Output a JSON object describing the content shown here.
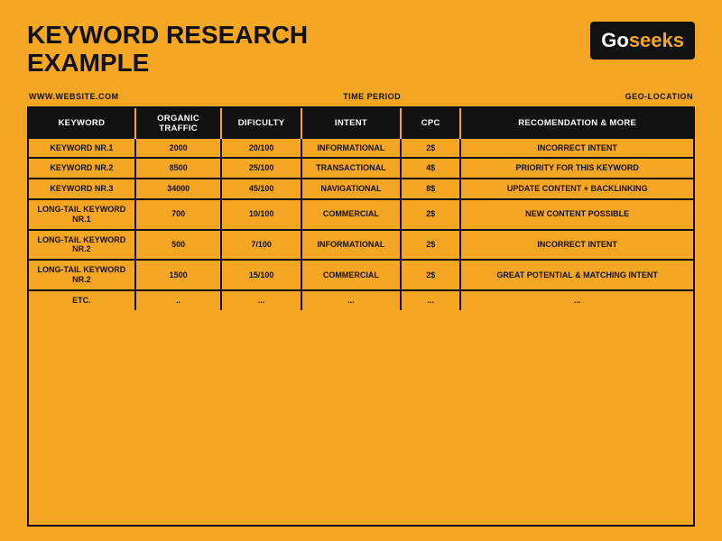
{
  "header": {
    "title_line1": "KEYWORD RESEARCH",
    "title_line2": "EXAMPLE",
    "logo_go": "Go",
    "logo_seeks": "seeks"
  },
  "meta": {
    "website": "WWW.WEBSITE.COM",
    "time_period": "TIME PERIOD",
    "geo_location": "GEO-LOCATION"
  },
  "table": {
    "columns": [
      {
        "id": "keyword",
        "label": "KEYWORD"
      },
      {
        "id": "traffic",
        "label": "ORGANIC TRAFFIC"
      },
      {
        "id": "difficulty",
        "label": "DIFICULTY"
      },
      {
        "id": "intent",
        "label": "INTENT"
      },
      {
        "id": "cpc",
        "label": "CPC"
      },
      {
        "id": "recommendation",
        "label": "RECOMENDATION & MORE"
      }
    ],
    "rows": [
      {
        "keyword": "KEYWORD NR.1",
        "traffic": "2000",
        "difficulty": "20/100",
        "intent": "INFORMATIONAL",
        "cpc": "2$",
        "recommendation": "INCORRECT INTENT"
      },
      {
        "keyword": "KEYWORD NR.2",
        "traffic": "8500",
        "difficulty": "25/100",
        "intent": "TRANSACTIONAL",
        "cpc": "4$",
        "recommendation": "PRIORITY FOR THIS KEYWORD"
      },
      {
        "keyword": "KEYWORD NR.3",
        "traffic": "34000",
        "difficulty": "45/100",
        "intent": "NAVIGATIONAL",
        "cpc": "8$",
        "recommendation": "UPDATE CONTENT + BACKLINKING"
      },
      {
        "keyword": "LONG-TAIL KEYWORD NR.1",
        "traffic": "700",
        "difficulty": "10/100",
        "intent": "COMMERCIAL",
        "cpc": "2$",
        "recommendation": "NEW CONTENT POSSIBLE"
      },
      {
        "keyword": "LONG-TAIL KEYWORD NR.2",
        "traffic": "500",
        "difficulty": "7/100",
        "intent": "INFORMATIONAL",
        "cpc": "2$",
        "recommendation": "INCORRECT INTENT"
      },
      {
        "keyword": "LONG-TAIL KEYWORD NR.2",
        "traffic": "1500",
        "difficulty": "15/100",
        "intent": "COMMERCIAL",
        "cpc": "2$",
        "recommendation": "GREAT POTENTIAL & MATCHING INTENT"
      },
      {
        "keyword": "ETC.",
        "traffic": "..",
        "difficulty": "...",
        "intent": "...",
        "cpc": "...",
        "recommendation": "..."
      }
    ]
  }
}
